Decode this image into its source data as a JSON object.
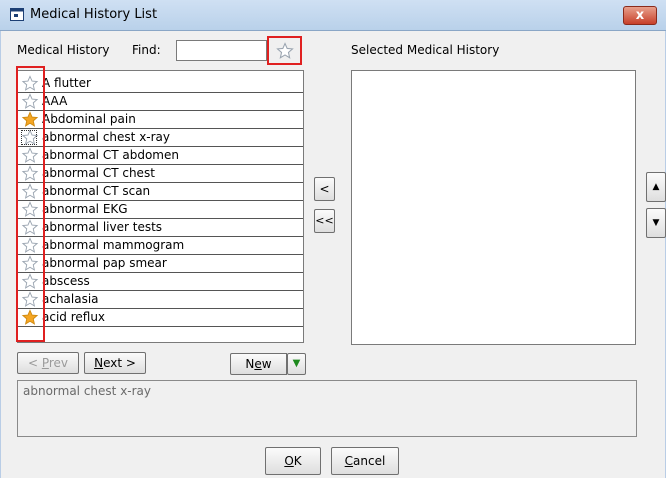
{
  "window": {
    "title": "Medical History List",
    "close_glyph": "x"
  },
  "left_panel": {
    "label": "Medical History",
    "find_label": "Find:",
    "find_value": "",
    "star_toggle_icon": "star-outline-icon"
  },
  "right_panel": {
    "label": "Selected Medical History"
  },
  "list": {
    "items": [
      {
        "label": "A flutter",
        "starred": false
      },
      {
        "label": "AAA",
        "starred": false
      },
      {
        "label": "Abdominal pain",
        "starred": true
      },
      {
        "label": "abnormal chest x-ray",
        "starred": false,
        "focused": true
      },
      {
        "label": "abnormal CT abdomen",
        "starred": false
      },
      {
        "label": "abnormal CT chest",
        "starred": false
      },
      {
        "label": "abnormal CT scan",
        "starred": false
      },
      {
        "label": "abnormal EKG",
        "starred": false
      },
      {
        "label": "abnormal liver tests",
        "starred": false
      },
      {
        "label": "abnormal mammogram",
        "starred": false
      },
      {
        "label": "abnormal pap smear",
        "starred": false
      },
      {
        "label": "abscess",
        "starred": false
      },
      {
        "label": "achalasia",
        "starred": false
      },
      {
        "label": "acid reflux",
        "starred": true
      }
    ]
  },
  "buttons": {
    "move_left": "<",
    "move_all_left": "<<",
    "move_up": "▲",
    "move_down": "▼",
    "prev_p": "P",
    "prev_rest": "rev",
    "prev_prefix": "< ",
    "next_n": "N",
    "next_rest": "ext >",
    "new_n": "N",
    "new_e": "e",
    "new_w": "w",
    "new_dropdown": "▼",
    "ok_o": "O",
    "ok_k": "K",
    "cancel_c": "C",
    "cancel_rest": "ancel"
  },
  "description": {
    "text": "abnormal chest x-ray"
  },
  "colors": {
    "highlight_red": "#e02020",
    "star_gold": "#f5a623"
  }
}
